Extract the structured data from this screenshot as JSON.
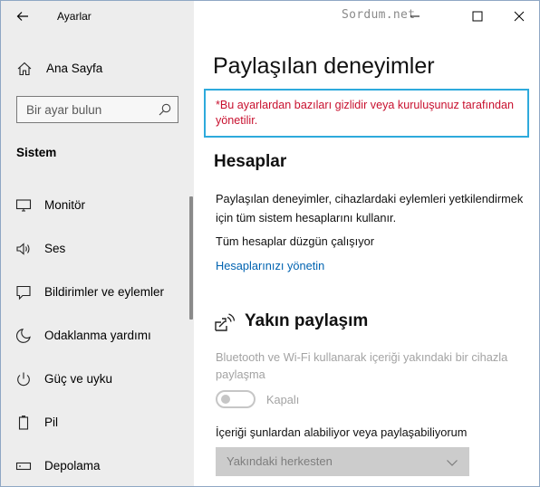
{
  "window": {
    "app_title": "Ayarlar",
    "watermark": "Sordum.net"
  },
  "sidebar": {
    "home_label": "Ana Sayfa",
    "search_placeholder": "Bir ayar bulun",
    "section_label": "Sistem",
    "items": [
      {
        "label": "Monitör",
        "icon": "monitor-icon"
      },
      {
        "label": "Ses",
        "icon": "speaker-icon"
      },
      {
        "label": "Bildirimler ve eylemler",
        "icon": "notification-icon"
      },
      {
        "label": "Odaklanma yardımı",
        "icon": "moon-icon"
      },
      {
        "label": "Güç ve uyku",
        "icon": "power-icon"
      },
      {
        "label": "Pil",
        "icon": "battery-icon"
      },
      {
        "label": "Depolama",
        "icon": "storage-icon"
      }
    ]
  },
  "main": {
    "title": "Paylaşılan deneyimler",
    "notice": "*Bu ayarlardan bazıları gizlidir veya kuruluşunuz tarafından yönetilir.",
    "accounts": {
      "heading": "Hesaplar",
      "description": "Paylaşılan deneyimler, cihazlardaki eylemleri yetkilendirmek için tüm sistem hesaplarını kullanır.",
      "status": "Tüm hesaplar düzgün çalışıyor",
      "manage_link": "Hesaplarınızı yönetin"
    },
    "nearby": {
      "heading": "Yakın paylaşım",
      "description": "Bluetooth ve Wi-Fi kullanarak içeriği yakındaki bir cihazla paylaşma",
      "toggle_state": "Kapalı",
      "receive_label": "İçeriği şunlardan alabiliyor veya paylaşabiliyorum",
      "receive_value": "Yakındaki herkesten"
    }
  },
  "colors": {
    "sidebar_bg": "#ededed",
    "notice_border": "#2eaadc",
    "notice_text": "#c8102e",
    "link": "#0063b1",
    "disabled": "#a3a3a3"
  }
}
